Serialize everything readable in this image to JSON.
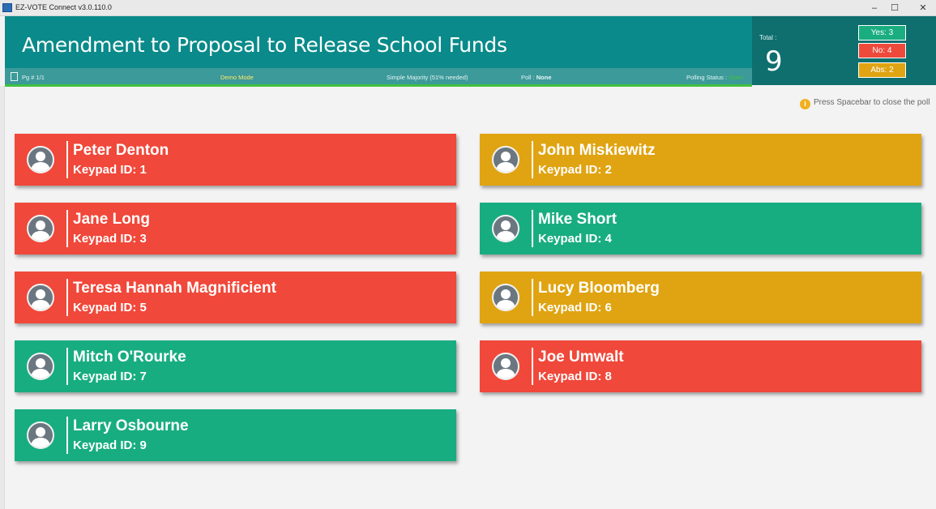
{
  "window": {
    "title": "EZ-VOTE Connect v3.0.110.0",
    "controls": {
      "minimize": "–",
      "maximize": "☐",
      "close": "✕"
    }
  },
  "header": {
    "title": "Amendment to Proposal to Release School Funds",
    "page": "Pg # 1/1",
    "mode": "Demo Mode",
    "majority": "Simple Majority (51% needed)",
    "poll_label": "Poll : ",
    "poll_value": "None",
    "polling_status_label": "Polling Status : ",
    "polling_status_value": "Open"
  },
  "totals": {
    "label": "Total :",
    "value": "9",
    "yes": "Yes: 3",
    "no": "No: 4",
    "abs": "Abs: 2"
  },
  "hint": {
    "icon": "i",
    "text": "Press Spacebar to close the poll"
  },
  "colors": {
    "yes": "#18ad80",
    "no": "#f0483a",
    "abstain": "#e0a412",
    "header": "#0a8a8a"
  },
  "voters": [
    {
      "name": "Peter Denton",
      "keypad": "Keypad ID: 1",
      "vote": "no"
    },
    {
      "name": "John Miskiewitz",
      "keypad": "Keypad ID: 2",
      "vote": "abstain"
    },
    {
      "name": "Jane Long",
      "keypad": "Keypad ID: 3",
      "vote": "no"
    },
    {
      "name": "Mike Short",
      "keypad": "Keypad ID: 4",
      "vote": "yes"
    },
    {
      "name": "Teresa Hannah Magnificient",
      "keypad": "Keypad ID: 5",
      "vote": "no"
    },
    {
      "name": "Lucy Bloomberg",
      "keypad": "Keypad ID: 6",
      "vote": "abstain"
    },
    {
      "name": "Mitch O'Rourke",
      "keypad": "Keypad ID: 7",
      "vote": "yes"
    },
    {
      "name": "Joe Umwalt",
      "keypad": "Keypad ID: 8",
      "vote": "no"
    },
    {
      "name": "Larry Osbourne",
      "keypad": "Keypad ID: 9",
      "vote": "yes"
    }
  ]
}
